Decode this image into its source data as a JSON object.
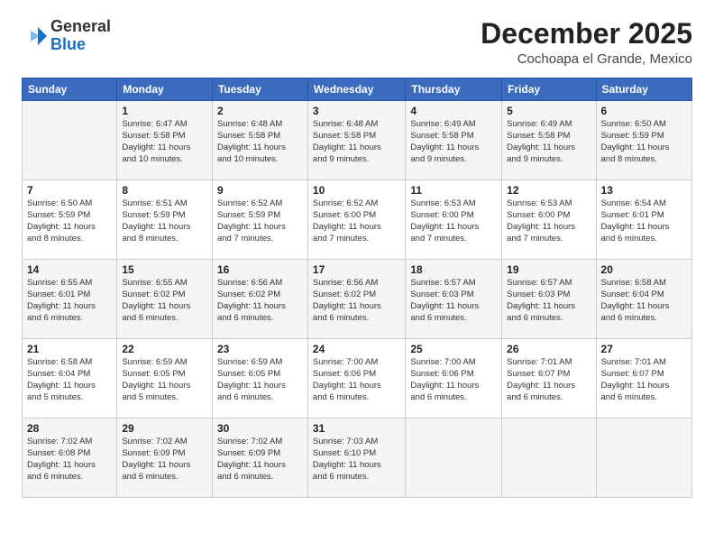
{
  "logo": {
    "general": "General",
    "blue": "Blue"
  },
  "header": {
    "month": "December 2025",
    "location": "Cochoapa el Grande, Mexico"
  },
  "weekdays": [
    "Sunday",
    "Monday",
    "Tuesday",
    "Wednesday",
    "Thursday",
    "Friday",
    "Saturday"
  ],
  "weeks": [
    [
      {
        "day": "",
        "info": ""
      },
      {
        "day": "1",
        "info": "Sunrise: 6:47 AM\nSunset: 5:58 PM\nDaylight: 11 hours\nand 10 minutes."
      },
      {
        "day": "2",
        "info": "Sunrise: 6:48 AM\nSunset: 5:58 PM\nDaylight: 11 hours\nand 10 minutes."
      },
      {
        "day": "3",
        "info": "Sunrise: 6:48 AM\nSunset: 5:58 PM\nDaylight: 11 hours\nand 9 minutes."
      },
      {
        "day": "4",
        "info": "Sunrise: 6:49 AM\nSunset: 5:58 PM\nDaylight: 11 hours\nand 9 minutes."
      },
      {
        "day": "5",
        "info": "Sunrise: 6:49 AM\nSunset: 5:58 PM\nDaylight: 11 hours\nand 9 minutes."
      },
      {
        "day": "6",
        "info": "Sunrise: 6:50 AM\nSunset: 5:59 PM\nDaylight: 11 hours\nand 8 minutes."
      }
    ],
    [
      {
        "day": "7",
        "info": "Sunrise: 6:50 AM\nSunset: 5:59 PM\nDaylight: 11 hours\nand 8 minutes."
      },
      {
        "day": "8",
        "info": "Sunrise: 6:51 AM\nSunset: 5:59 PM\nDaylight: 11 hours\nand 8 minutes."
      },
      {
        "day": "9",
        "info": "Sunrise: 6:52 AM\nSunset: 5:59 PM\nDaylight: 11 hours\nand 7 minutes."
      },
      {
        "day": "10",
        "info": "Sunrise: 6:52 AM\nSunset: 6:00 PM\nDaylight: 11 hours\nand 7 minutes."
      },
      {
        "day": "11",
        "info": "Sunrise: 6:53 AM\nSunset: 6:00 PM\nDaylight: 11 hours\nand 7 minutes."
      },
      {
        "day": "12",
        "info": "Sunrise: 6:53 AM\nSunset: 6:00 PM\nDaylight: 11 hours\nand 7 minutes."
      },
      {
        "day": "13",
        "info": "Sunrise: 6:54 AM\nSunset: 6:01 PM\nDaylight: 11 hours\nand 6 minutes."
      }
    ],
    [
      {
        "day": "14",
        "info": "Sunrise: 6:55 AM\nSunset: 6:01 PM\nDaylight: 11 hours\nand 6 minutes."
      },
      {
        "day": "15",
        "info": "Sunrise: 6:55 AM\nSunset: 6:02 PM\nDaylight: 11 hours\nand 6 minutes."
      },
      {
        "day": "16",
        "info": "Sunrise: 6:56 AM\nSunset: 6:02 PM\nDaylight: 11 hours\nand 6 minutes."
      },
      {
        "day": "17",
        "info": "Sunrise: 6:56 AM\nSunset: 6:02 PM\nDaylight: 11 hours\nand 6 minutes."
      },
      {
        "day": "18",
        "info": "Sunrise: 6:57 AM\nSunset: 6:03 PM\nDaylight: 11 hours\nand 6 minutes."
      },
      {
        "day": "19",
        "info": "Sunrise: 6:57 AM\nSunset: 6:03 PM\nDaylight: 11 hours\nand 6 minutes."
      },
      {
        "day": "20",
        "info": "Sunrise: 6:58 AM\nSunset: 6:04 PM\nDaylight: 11 hours\nand 6 minutes."
      }
    ],
    [
      {
        "day": "21",
        "info": "Sunrise: 6:58 AM\nSunset: 6:04 PM\nDaylight: 11 hours\nand 5 minutes."
      },
      {
        "day": "22",
        "info": "Sunrise: 6:59 AM\nSunset: 6:05 PM\nDaylight: 11 hours\nand 5 minutes."
      },
      {
        "day": "23",
        "info": "Sunrise: 6:59 AM\nSunset: 6:05 PM\nDaylight: 11 hours\nand 6 minutes."
      },
      {
        "day": "24",
        "info": "Sunrise: 7:00 AM\nSunset: 6:06 PM\nDaylight: 11 hours\nand 6 minutes."
      },
      {
        "day": "25",
        "info": "Sunrise: 7:00 AM\nSunset: 6:06 PM\nDaylight: 11 hours\nand 6 minutes."
      },
      {
        "day": "26",
        "info": "Sunrise: 7:01 AM\nSunset: 6:07 PM\nDaylight: 11 hours\nand 6 minutes."
      },
      {
        "day": "27",
        "info": "Sunrise: 7:01 AM\nSunset: 6:07 PM\nDaylight: 11 hours\nand 6 minutes."
      }
    ],
    [
      {
        "day": "28",
        "info": "Sunrise: 7:02 AM\nSunset: 6:08 PM\nDaylight: 11 hours\nand 6 minutes."
      },
      {
        "day": "29",
        "info": "Sunrise: 7:02 AM\nSunset: 6:09 PM\nDaylight: 11 hours\nand 6 minutes."
      },
      {
        "day": "30",
        "info": "Sunrise: 7:02 AM\nSunset: 6:09 PM\nDaylight: 11 hours\nand 6 minutes."
      },
      {
        "day": "31",
        "info": "Sunrise: 7:03 AM\nSunset: 6:10 PM\nDaylight: 11 hours\nand 6 minutes."
      },
      {
        "day": "",
        "info": ""
      },
      {
        "day": "",
        "info": ""
      },
      {
        "day": "",
        "info": ""
      }
    ]
  ]
}
